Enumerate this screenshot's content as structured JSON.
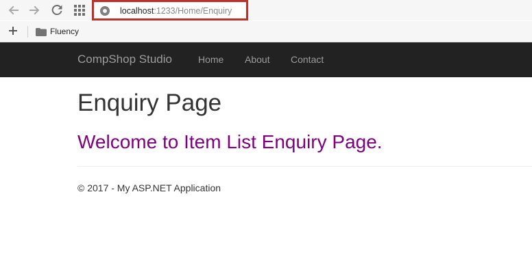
{
  "browser": {
    "address_host": "localhost",
    "address_path": ":1233/Home/Enquiry",
    "icons": [
      "back-arrow-icon",
      "forward-arrow-icon",
      "reload-icon",
      "apps-grid-icon",
      "site-info-icon"
    ]
  },
  "bookmarks": {
    "add_icon": "plus-icon",
    "folder_icon": "folder-icon",
    "items": [
      {
        "label": "Fluency"
      }
    ]
  },
  "navbar": {
    "brand": "CompShop Studio",
    "links": [
      {
        "label": "Home"
      },
      {
        "label": "About"
      },
      {
        "label": "Contact"
      }
    ]
  },
  "main": {
    "title": "Enquiry Page",
    "welcome": "Welcome to Item List Enquiry Page."
  },
  "footer": {
    "text": "© 2017 - My ASP.NET Application"
  },
  "colors": {
    "navbar_bg": "#222222",
    "navbar_text": "#9d9d9d",
    "welcome_text": "#800080",
    "address_highlight": "#c0302a"
  }
}
